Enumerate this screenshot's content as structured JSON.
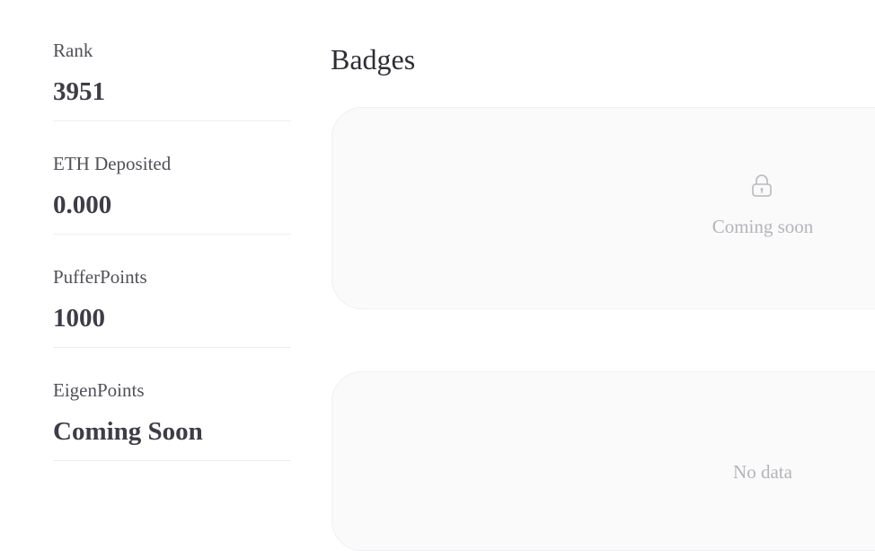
{
  "stats": [
    {
      "label": "Rank",
      "value": "3951"
    },
    {
      "label": "ETH Deposited",
      "value": "0.000"
    },
    {
      "label": "PufferPoints",
      "value": "1000"
    },
    {
      "label": "EigenPoints",
      "value": "Coming Soon"
    }
  ],
  "badges": {
    "title": "Badges",
    "status_text": "Coming soon",
    "icon": "lock-icon"
  },
  "second_panel": {
    "empty_text": "No data"
  },
  "colors": {
    "panel_bg": "#fafafa",
    "muted_text": "#b4b4bc",
    "value_text": "#3d3d47"
  }
}
